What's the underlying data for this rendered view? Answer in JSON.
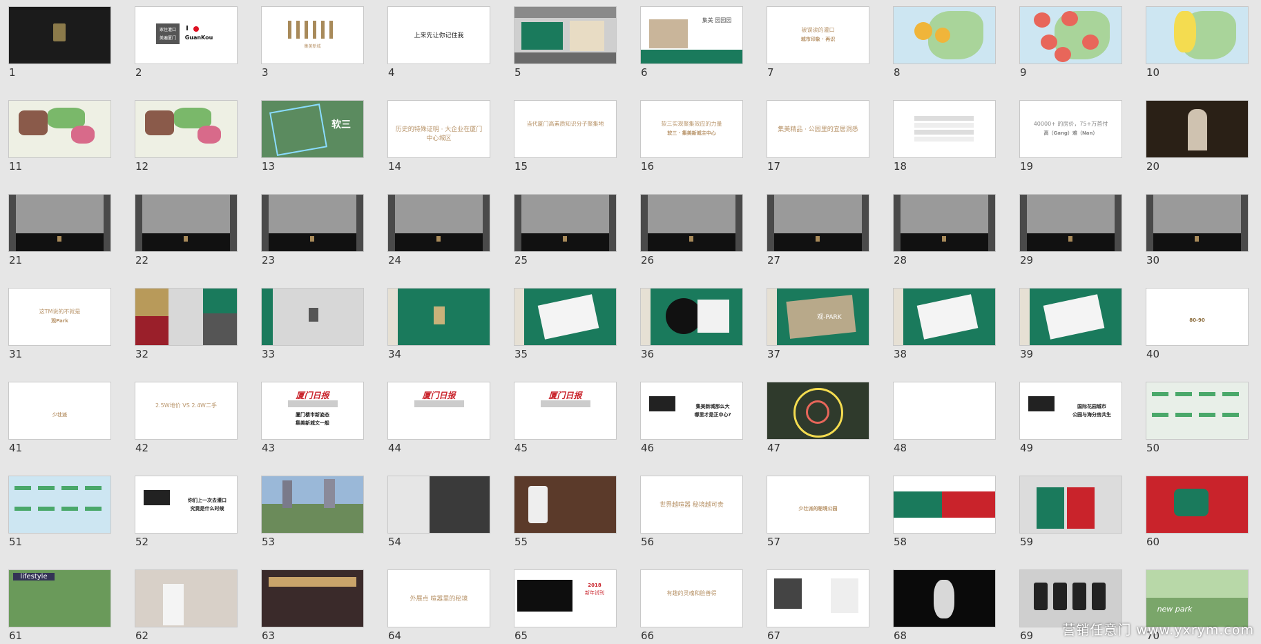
{
  "watermark": "营销任意门 www.yxrym.com",
  "slides": [
    {
      "n": "1",
      "bg": "#1b1b1b",
      "kind": "logo"
    },
    {
      "n": "2",
      "bg": "#ffffff",
      "kind": "ilove",
      "text1": "家住灌口",
      "text2": "美遍厦门",
      "text3": "I",
      "text4": "GuanKou"
    },
    {
      "n": "3",
      "bg": "#ffffff",
      "kind": "bottles",
      "text1": "集美新城"
    },
    {
      "n": "4",
      "bg": "#ffffff",
      "kind": "text",
      "text1": "上来先让你记住我",
      "color": "#222"
    },
    {
      "n": "5",
      "bg": "#cfcfcf",
      "kind": "street"
    },
    {
      "n": "6",
      "bg": "#ffffff",
      "kind": "building",
      "text1": "集美 园园园"
    },
    {
      "n": "7",
      "bg": "#ffffff",
      "kind": "text2",
      "text1": "被误读的灌口",
      "text2": "城市印象 · 再识",
      "color": "#b8946a"
    },
    {
      "n": "8",
      "bg": "#cde6f2",
      "kind": "map"
    },
    {
      "n": "9",
      "bg": "#cde6f2",
      "kind": "mapred"
    },
    {
      "n": "10",
      "bg": "#cde6f2",
      "kind": "mapy"
    },
    {
      "n": "11",
      "bg": "#cde6f2",
      "kind": "mapzone"
    },
    {
      "n": "12",
      "bg": "#cde6f2",
      "kind": "mapzone"
    },
    {
      "n": "13",
      "bg": "#5b8b5f",
      "kind": "aerial",
      "text1": "软三"
    },
    {
      "n": "14",
      "bg": "#ffffff",
      "kind": "text",
      "text1": "历史的特殊证明 · 大企业在厦门中心城区",
      "color": "#b8946a"
    },
    {
      "n": "15",
      "bg": "#ffffff",
      "kind": "text2",
      "text1": "当代厦门高素质知识分子聚集地",
      "text2": "",
      "color": "#b8946a"
    },
    {
      "n": "16",
      "bg": "#ffffff",
      "kind": "text2",
      "text1": "软三实现聚集效应的力量",
      "text2": "软三 · 集美新城主中心",
      "color": "#b8946a"
    },
    {
      "n": "17",
      "bg": "#ffffff",
      "kind": "text",
      "text1": "集美精品 · 公园里的宜居洞悉",
      "color": "#b8946a"
    },
    {
      "n": "18",
      "bg": "#ffffff",
      "kind": "table"
    },
    {
      "n": "19",
      "bg": "#ffffff",
      "kind": "text2",
      "text1": "40000+ 的房价，75+万首付",
      "text2": "高（Gang）难（Nan）",
      "color": "#888"
    },
    {
      "n": "20",
      "bg": "#2a2016",
      "kind": "photo"
    },
    {
      "n": "21",
      "bg": "#4a4a4a",
      "kind": "bw"
    },
    {
      "n": "22",
      "bg": "#4a4a4a",
      "kind": "bw"
    },
    {
      "n": "23",
      "bg": "#4a4a4a",
      "kind": "bw"
    },
    {
      "n": "24",
      "bg": "#4a4a4a",
      "kind": "bw"
    },
    {
      "n": "25",
      "bg": "#4a4a4a",
      "kind": "bw"
    },
    {
      "n": "26",
      "bg": "#4a4a4a",
      "kind": "bw"
    },
    {
      "n": "27",
      "bg": "#4a4a4a",
      "kind": "bw"
    },
    {
      "n": "28",
      "bg": "#4a4a4a",
      "kind": "bw"
    },
    {
      "n": "29",
      "bg": "#4a4a4a",
      "kind": "bw"
    },
    {
      "n": "30",
      "bg": "#4a4a4a",
      "kind": "bw"
    },
    {
      "n": "31",
      "bg": "#ffffff",
      "kind": "text2",
      "text1": "这TM说的不就是",
      "text2": "观Park",
      "color": "#b8946a"
    },
    {
      "n": "32",
      "bg": "#ffffff",
      "kind": "collage"
    },
    {
      "n": "33",
      "bg": "#d7d7d7",
      "kind": "greycard"
    },
    {
      "n": "34",
      "bg": "#1a7a5c",
      "kind": "green"
    },
    {
      "n": "35",
      "bg": "#1a7a5c",
      "kind": "greencard"
    },
    {
      "n": "36",
      "bg": "#1a7a5c",
      "kind": "greenvinyl"
    },
    {
      "n": "37",
      "bg": "#1a7a5c",
      "kind": "greenpark",
      "text1": "观-PARK"
    },
    {
      "n": "38",
      "bg": "#1a7a5c",
      "kind": "greencard"
    },
    {
      "n": "39",
      "bg": "#1a7a5c",
      "kind": "greencard"
    },
    {
      "n": "40",
      "bg": "#ffffff",
      "kind": "text2",
      "text1": "",
      "text2": "80-90",
      "color": "#8a6a3a"
    },
    {
      "n": "41",
      "bg": "#ffffff",
      "kind": "text2",
      "text1": "",
      "text2": "少壮派",
      "color": "#b8946a"
    },
    {
      "n": "42",
      "bg": "#ffffff",
      "kind": "text2",
      "text1": "2.5W地价 VS 2.4W二手",
      "text2": "",
      "color": "#b8946a"
    },
    {
      "n": "43",
      "bg": "#ffffff",
      "kind": "xiamen",
      "text1": "厦门日报",
      "text2": "厦门楼市新姿态",
      "text3": "集美新城文一般"
    },
    {
      "n": "44",
      "bg": "#ffffff",
      "kind": "xiamen",
      "text1": "厦门日报",
      "text2": "",
      "text3": ""
    },
    {
      "n": "45",
      "bg": "#ffffff",
      "kind": "xiamen",
      "text1": "厦门日报",
      "text2": "",
      "text3": ""
    },
    {
      "n": "46",
      "bg": "#ffffff",
      "kind": "phone",
      "text1": "集美新城那么大",
      "text2": "哪里才是正中心?"
    },
    {
      "n": "47",
      "bg": "#2f3a2c",
      "kind": "circle"
    },
    {
      "n": "48",
      "bg": "#ffffff",
      "kind": "text2",
      "text1": "",
      "text2": "",
      "color": "#b8946a"
    },
    {
      "n": "49",
      "bg": "#ffffff",
      "kind": "phone",
      "text1": "国际花园城市",
      "text2": "公园与海分房共生"
    },
    {
      "n": "50",
      "bg": "#e8efe8",
      "kind": "map2"
    },
    {
      "n": "51",
      "bg": "#cde6f2",
      "kind": "map2"
    },
    {
      "n": "52",
      "bg": "#ffffff",
      "kind": "phone",
      "text1": "你们上一次去灌口",
      "text2": "究竟是什么时候"
    },
    {
      "n": "53",
      "bg": "#6b8b5a",
      "kind": "park",
      "text1": ""
    },
    {
      "n": "54",
      "bg": "#3a3a3a",
      "kind": "hand",
      "text1": ""
    },
    {
      "n": "55",
      "bg": "#5b3a2a",
      "kind": "iphone",
      "text1": ""
    },
    {
      "n": "56",
      "bg": "#ffffff",
      "kind": "text",
      "text1": "世界越喧嚣 秘境越可贵",
      "color": "#b8946a"
    },
    {
      "n": "57",
      "bg": "#ffffff",
      "kind": "text2",
      "text1": "",
      "text2": "少壮派的秘境公园",
      "color": "#b8946a"
    },
    {
      "n": "58",
      "bg": "#ffffff",
      "kind": "redgreen"
    },
    {
      "n": "59",
      "bg": "#dcdcdc",
      "kind": "redposter"
    },
    {
      "n": "60",
      "bg": "#c9232b",
      "kind": "redbig"
    },
    {
      "n": "61",
      "bg": "#6a9a5a",
      "kind": "lifestyle",
      "text1": "lifestyle"
    },
    {
      "n": "62",
      "bg": "#d8d0c8",
      "kind": "artist"
    },
    {
      "n": "63",
      "bg": "#3a2a2a",
      "kind": "shop"
    },
    {
      "n": "64",
      "bg": "#ffffff",
      "kind": "text",
      "text1": "外展点 喧嚣里的秘境",
      "color": "#b8946a"
    },
    {
      "n": "65",
      "bg": "#ffffff",
      "kind": "black2018",
      "text1": "2018",
      "text2": "新年试刊"
    },
    {
      "n": "66",
      "bg": "#ffffff",
      "kind": "text2",
      "text1": "有趣的灵魂和脸善得",
      "text2": "",
      "color": "#b8946a"
    },
    {
      "n": "67",
      "bg": "#ffffff",
      "kind": "people"
    },
    {
      "n": "68",
      "bg": "#0a0a0a",
      "kind": "dark"
    },
    {
      "n": "69",
      "bg": "#cfcfcf",
      "kind": "phones"
    },
    {
      "n": "70",
      "bg": "#7aa66a",
      "kind": "newpark",
      "text1": "new park"
    }
  ]
}
